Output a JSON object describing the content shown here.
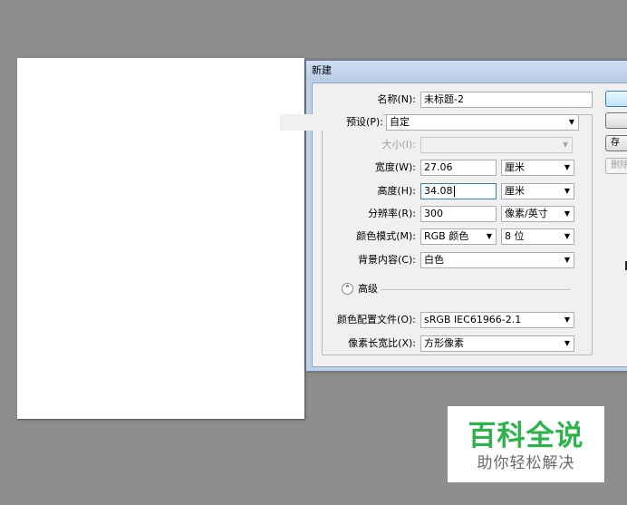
{
  "dialog": {
    "title": "新建",
    "fields": {
      "name": {
        "label": "名称(N):",
        "value": "未标题-2"
      },
      "preset": {
        "label": "预设(P):",
        "value": "自定"
      },
      "size": {
        "label": "大小(I):",
        "value": ""
      },
      "width": {
        "label": "宽度(W):",
        "value": "27.06",
        "unit": "厘米"
      },
      "height": {
        "label": "高度(H):",
        "value": "34.08",
        "unit": "厘米"
      },
      "resolution": {
        "label": "分辨率(R):",
        "value": "300",
        "unit": "像素/英寸"
      },
      "color_mode": {
        "label": "颜色模式(M):",
        "value": "RGB 颜色",
        "depth": "8 位"
      },
      "background": {
        "label": "背景内容(C):",
        "value": "白色"
      },
      "advanced": {
        "label": "高级"
      },
      "color_profile": {
        "label": "颜色配置文件(O):",
        "value": "sRGB IEC61966-2.1"
      },
      "pixel_aspect": {
        "label": "像素长宽比(X):",
        "value": "方形像素"
      }
    },
    "buttons": {
      "save_preset": "存",
      "delete_preset": "删除"
    }
  },
  "watermark": {
    "title": "百科全说",
    "subtitle": "助你轻松解决"
  }
}
